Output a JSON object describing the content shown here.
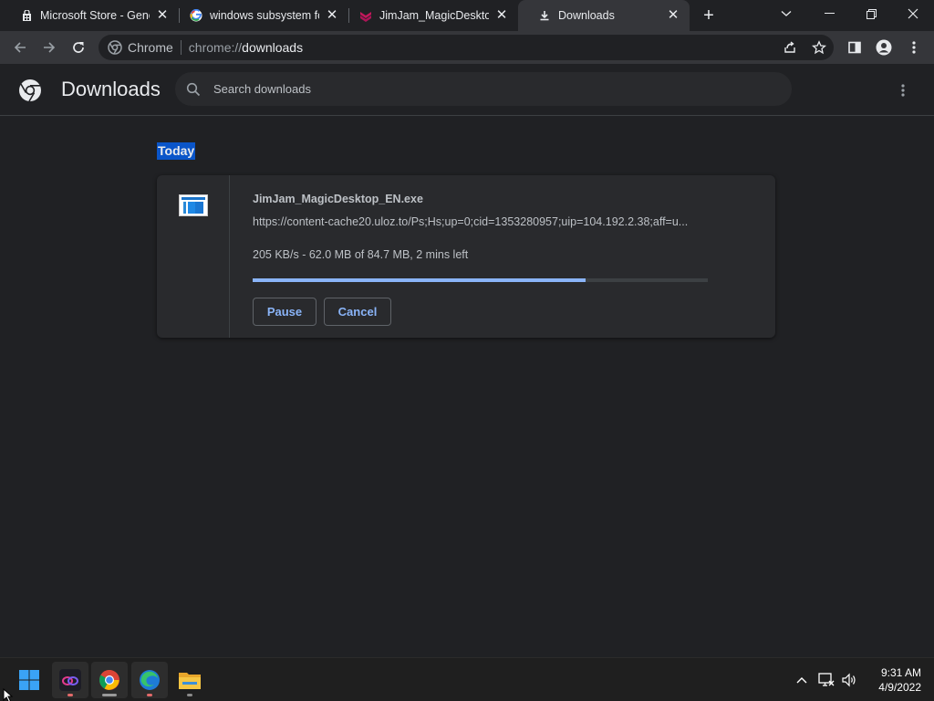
{
  "browser": {
    "tabs": [
      {
        "title": "Microsoft Store - Gene",
        "icon": "microsoft-store-icon",
        "active": false
      },
      {
        "title": "windows subsystem for",
        "icon": "google-icon",
        "active": false
      },
      {
        "title": "JimJam_MagicDesktop",
        "icon": "jimjam-icon",
        "active": false
      },
      {
        "title": "Downloads",
        "icon": "download-icon",
        "active": true
      }
    ],
    "omnibox": {
      "chip": "Chrome",
      "scheme": "chrome://",
      "host": "downloads"
    }
  },
  "downloads": {
    "title": "Downloads",
    "search_placeholder": "Search downloads",
    "section": "Today",
    "item": {
      "filename": "JimJam_MagicDesktop_EN.exe",
      "url": "https://content-cache20.uloz.to/Ps;Hs;up=0;cid=1353280957;uip=104.192.2.38;aff=u...",
      "status": "205 KB/s - 62.0 MB of 84.7 MB, 2 mins left",
      "progress_fraction": 0.732,
      "pause_label": "Pause",
      "cancel_label": "Cancel"
    }
  },
  "taskbar": {
    "time": "9:31 AM",
    "date": "4/9/2022"
  },
  "colors": {
    "accent": "#8ab4f8",
    "selection": "#0a55c9",
    "background": "#202124"
  }
}
